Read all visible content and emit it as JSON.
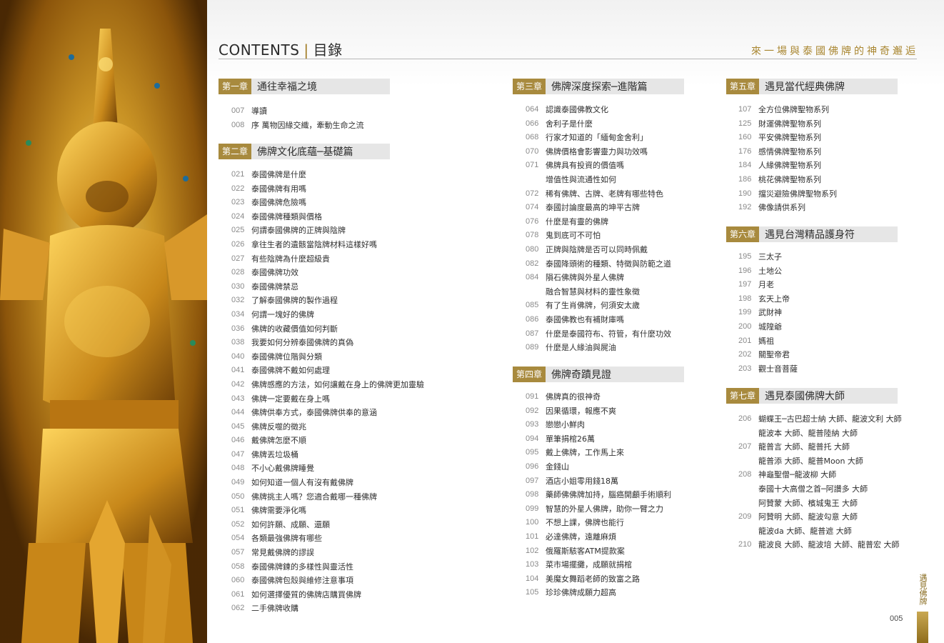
{
  "header": {
    "title_en": "CONTENTS",
    "title_zh": "目錄",
    "subtitle": "來一場與泰國佛牌的神奇邂逅"
  },
  "chapters": [
    {
      "num": "第一章",
      "name": "通往幸福之境",
      "items": [
        {
          "page": "007",
          "title": "導讀"
        },
        {
          "page": "008",
          "title": "序 萬物因緣交織，牽動生命之流"
        }
      ]
    },
    {
      "num": "第二章",
      "name": "佛牌文化底蘊─基礎篇",
      "items": [
        {
          "page": "021",
          "title": "泰國佛牌是什麼"
        },
        {
          "page": "022",
          "title": "泰國佛牌有用嗎"
        },
        {
          "page": "023",
          "title": "泰國佛牌危險嗎"
        },
        {
          "page": "024",
          "title": "泰國佛牌種類與價格"
        },
        {
          "page": "025",
          "title": "何謂泰國佛牌的正牌與陰牌"
        },
        {
          "page": "026",
          "title": "拿往生者的遺骸當陰牌材料這樣好嗎"
        },
        {
          "page": "027",
          "title": "有些陰牌為什麼超級貴"
        },
        {
          "page": "028",
          "title": "泰國佛牌功效"
        },
        {
          "page": "030",
          "title": "泰國佛牌禁忌"
        },
        {
          "page": "032",
          "title": "了解泰國佛牌的製作過程"
        },
        {
          "page": "034",
          "title": "何謂一塊好的佛牌"
        },
        {
          "page": "036",
          "title": "佛牌的收藏價值如何判斷"
        },
        {
          "page": "038",
          "title": "我要如何分辨泰國佛牌的真偽"
        },
        {
          "page": "040",
          "title": "泰國佛牌位階與分類"
        },
        {
          "page": "041",
          "title": "泰國佛牌不戴如何處理"
        },
        {
          "page": "042",
          "title": "佛牌感應的方法，如何讓戴在身上的佛牌更加靈驗"
        },
        {
          "page": "043",
          "title": "佛牌一定要戴在身上嗎"
        },
        {
          "page": "044",
          "title": "佛牌供奉方式，泰國佛牌供奉的意涵"
        },
        {
          "page": "045",
          "title": "佛牌反噬的徵兆"
        },
        {
          "page": "046",
          "title": "戴佛牌怎麼不順"
        },
        {
          "page": "047",
          "title": "佛牌丟垃圾桶"
        },
        {
          "page": "048",
          "title": "不小心戴佛牌睡覺"
        },
        {
          "page": "049",
          "title": "如何知道一個人有沒有戴佛牌"
        },
        {
          "page": "050",
          "title": "佛牌挑主人嗎？您適合戴哪一種佛牌"
        },
        {
          "page": "051",
          "title": "佛牌需要淨化嗎"
        },
        {
          "page": "052",
          "title": "如何許願、成願、還願"
        },
        {
          "page": "054",
          "title": "各類最強佛牌有哪些"
        },
        {
          "page": "057",
          "title": "常見戴佛牌的謬誤"
        },
        {
          "page": "058",
          "title": "泰國佛牌鍊的多樣性與靈活性"
        },
        {
          "page": "060",
          "title": "泰國佛牌包殼與維修注意事項"
        },
        {
          "page": "061",
          "title": "如何選擇優質的佛牌店購買佛牌"
        },
        {
          "page": "062",
          "title": "二手佛牌收購"
        }
      ]
    },
    {
      "num": "第三章",
      "name": "佛牌深度探索─進階篇",
      "items": [
        {
          "page": "064",
          "title": "認識泰國佛教文化"
        },
        {
          "page": "066",
          "title": "舍利子是什麼"
        },
        {
          "page": "068",
          "title": "行家才知道的「緬甸金舍利」"
        },
        {
          "page": "070",
          "title": "佛牌價格會影響靈力與功效嗎"
        },
        {
          "page": "071",
          "title": "佛牌具有投資的價值嗎"
        },
        {
          "page": "",
          "title": "增值性與流通性如何"
        },
        {
          "page": "072",
          "title": "稀有佛牌、古牌、老牌有哪些特色"
        },
        {
          "page": "074",
          "title": "泰國討論度最高的坤平古牌"
        },
        {
          "page": "076",
          "title": "什麼是有靈的佛牌"
        },
        {
          "page": "078",
          "title": "鬼到底可不可怕"
        },
        {
          "page": "080",
          "title": "正牌與陰牌是否可以同時佩戴"
        },
        {
          "page": "082",
          "title": "泰國降頭術的種類、特徵與防範之道"
        },
        {
          "page": "084",
          "title": "隕石佛牌與外星人佛牌"
        },
        {
          "page": "",
          "title": "融合智慧與材料的靈性象徵"
        },
        {
          "page": "085",
          "title": "有了生肖佛牌，何須安太歲"
        },
        {
          "page": "086",
          "title": "泰國佛教也有補財庫嗎"
        },
        {
          "page": "087",
          "title": "什麼是泰國符布、符管，有什麼功效"
        },
        {
          "page": "089",
          "title": "什麼是人緣油與屍油"
        }
      ]
    },
    {
      "num": "第四章",
      "name": "佛牌奇蹟見證",
      "items": [
        {
          "page": "091",
          "title": "佛牌真的很神奇"
        },
        {
          "page": "092",
          "title": "因果循環，報應不爽"
        },
        {
          "page": "093",
          "title": "戀戀小鮮肉"
        },
        {
          "page": "094",
          "title": "單筆捐棺26萬"
        },
        {
          "page": "095",
          "title": "戴上佛牌，工作馬上來"
        },
        {
          "page": "096",
          "title": "金錢山"
        },
        {
          "page": "097",
          "title": "酒店小姐零用錢18萬"
        },
        {
          "page": "098",
          "title": "藥師佛佛牌加持，腦癌開顱手術順利"
        },
        {
          "page": "099",
          "title": "智慧的外星人佛牌，助你一臂之力"
        },
        {
          "page": "100",
          "title": "不想上課，佛牌也能行"
        },
        {
          "page": "101",
          "title": "必達佛牌，遠離麻煩"
        },
        {
          "page": "102",
          "title": "俄羅斯駭客ATM提款案"
        },
        {
          "page": "103",
          "title": "菜市場擺攤，成願就捐棺"
        },
        {
          "page": "104",
          "title": "美魔女舞蹈老師的致富之路"
        },
        {
          "page": "105",
          "title": "珍珍佛牌成願力超高"
        }
      ]
    },
    {
      "num": "第五章",
      "name": "遇見當代經典佛牌",
      "items": [
        {
          "page": "107",
          "title": "全方位佛牌聖物系列"
        },
        {
          "page": "125",
          "title": "財運佛牌聖物系列"
        },
        {
          "page": "160",
          "title": "平安佛牌聖物系列"
        },
        {
          "page": "176",
          "title": "感情佛牌聖物系列"
        },
        {
          "page": "184",
          "title": "人緣佛牌聖物系列"
        },
        {
          "page": "186",
          "title": "桃花佛牌聖物系列"
        },
        {
          "page": "190",
          "title": "擋災避險佛牌聖物系列"
        },
        {
          "page": "192",
          "title": "佛像請供系列"
        }
      ]
    },
    {
      "num": "第六章",
      "name": "遇見台灣精品護身符",
      "items": [
        {
          "page": "195",
          "title": "三太子"
        },
        {
          "page": "196",
          "title": "土地公"
        },
        {
          "page": "197",
          "title": "月老"
        },
        {
          "page": "198",
          "title": "玄天上帝"
        },
        {
          "page": "199",
          "title": "武財神"
        },
        {
          "page": "200",
          "title": "城隍爺"
        },
        {
          "page": "201",
          "title": "媽祖"
        },
        {
          "page": "202",
          "title": "關聖帝君"
        },
        {
          "page": "203",
          "title": "觀士音菩薩"
        }
      ]
    },
    {
      "num": "第七章",
      "name": "遇見泰國佛牌大師",
      "items": [
        {
          "page": "206",
          "title": "蝴蝶王─古巴超士納 大師、龍波文利 大師"
        },
        {
          "page": "",
          "title": "龍波本 大師、龍普陸納 大師"
        },
        {
          "page": "207",
          "title": "龍普言 大師、龍普托 大師"
        },
        {
          "page": "",
          "title": "龍普添 大師、龍普Moon 大師"
        },
        {
          "page": "208",
          "title": "神龜聖僧─龍波柳 大師"
        },
        {
          "page": "",
          "title": "泰國十大高僧之首─阿讚多 大師"
        },
        {
          "page": "",
          "title": "阿贊蒙 大師、檳城鬼王 大師"
        },
        {
          "page": "209",
          "title": "阿贊明 大師、龍波勾意 大師"
        },
        {
          "page": "",
          "title": "龍波da 大師、龍普遮 大師"
        },
        {
          "page": "210",
          "title": "龍波良 大師、龍波培 大師、龍普宏 大師"
        }
      ]
    }
  ],
  "footer": {
    "page_number": "005",
    "side_tab": "遇見佛牌"
  },
  "colors": {
    "accent_gold": "#a88a3e",
    "chapter_bg": "#e6e6e6",
    "header_line": "#b7b7b7"
  }
}
